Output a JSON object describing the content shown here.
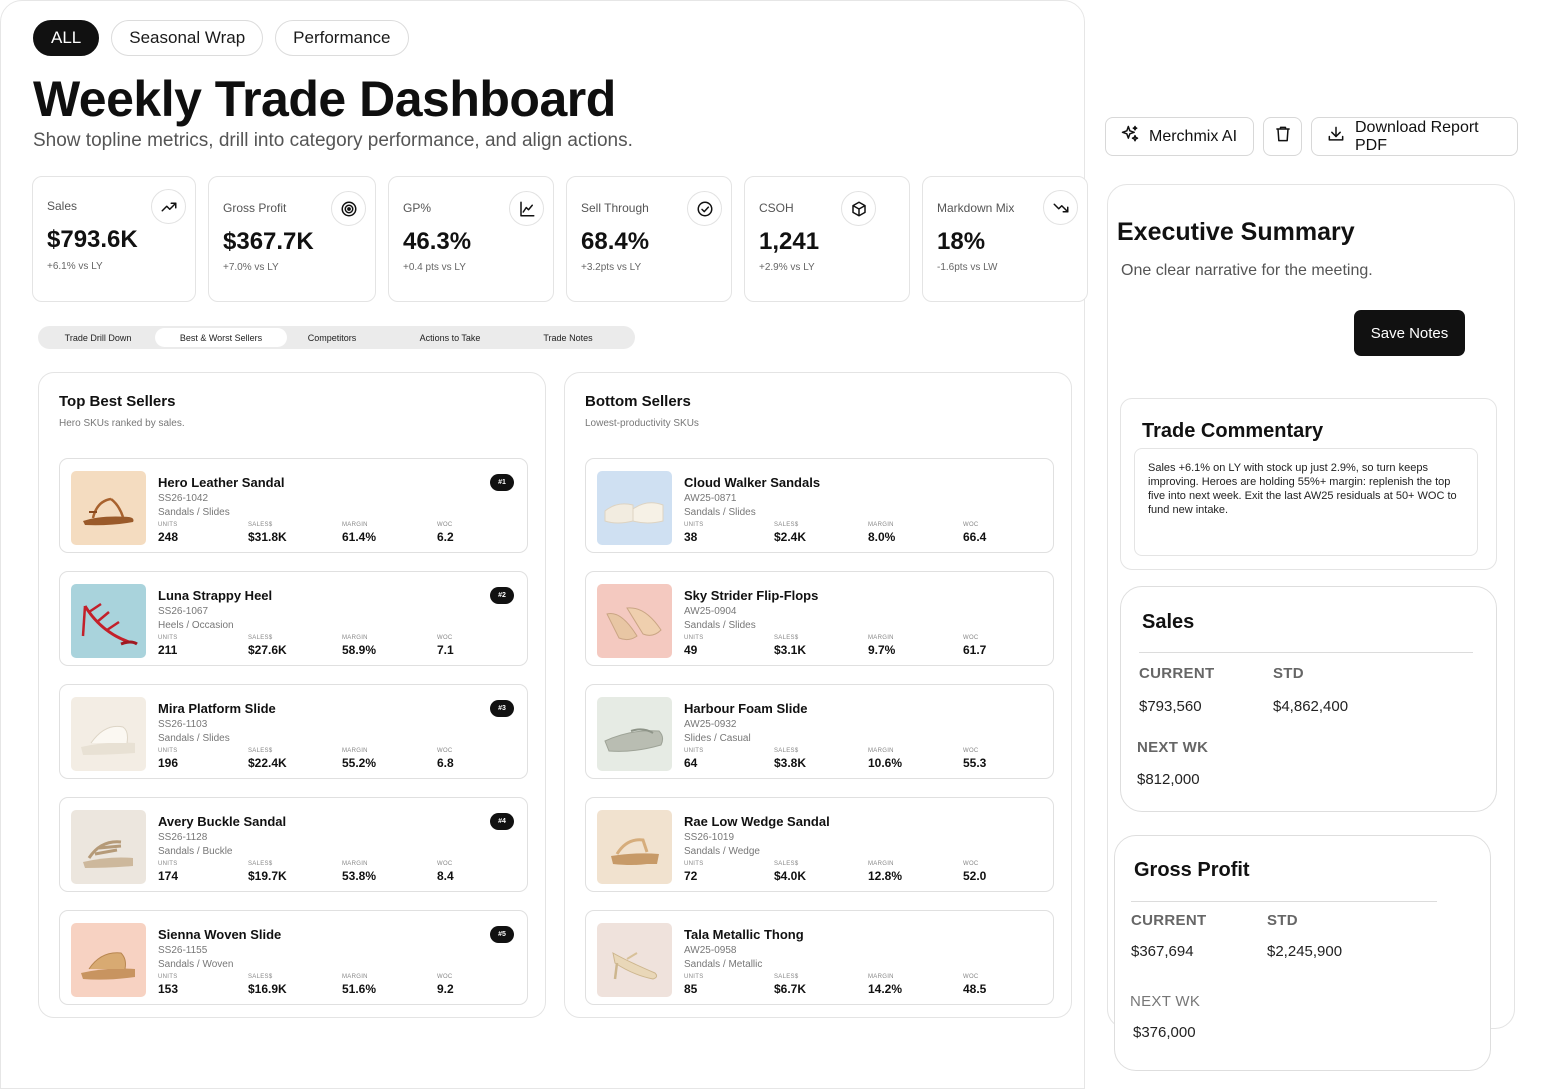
{
  "filters": [
    "ALL",
    "Seasonal Wrap",
    "Performance"
  ],
  "page": {
    "title": "Weekly Trade Dashboard",
    "subtitle": "Show topline metrics, drill into category performance, and align actions."
  },
  "kpis": [
    {
      "label": "Sales",
      "value": "$793.6K",
      "delta": "+6.1% vs LY",
      "icon": "trend-up-icon"
    },
    {
      "label": "Gross Profit",
      "value": "$367.7K",
      "delta": "+7.0% vs LY",
      "icon": "target-icon"
    },
    {
      "label": "GP%",
      "value": "46.3%",
      "delta": "+0.4 pts vs LY",
      "icon": "line-chart-icon"
    },
    {
      "label": "Sell Through",
      "value": "68.4%",
      "delta": "+3.2pts vs LY",
      "icon": "check-circle-icon"
    },
    {
      "label": "CSOH",
      "value": "1,241",
      "delta": "+2.9% vs LY",
      "icon": "box-icon"
    },
    {
      "label": "Markdown Mix",
      "value": "18%",
      "delta": "-1.6pts vs LW",
      "icon": "trend-down-icon"
    }
  ],
  "tabs": [
    "Trade Drill Down",
    "Best & Worst Sellers",
    "Competitors",
    "Actions to Take",
    "Trade Notes"
  ],
  "active_tab": "Best & Worst Sellers",
  "metric_labels": {
    "units": "UNITS",
    "sales": "SALES$",
    "margin": "MARGIN",
    "woc": "WOC"
  },
  "best_sellers": {
    "title": "Top Best Sellers",
    "subtitle": "Hero SKUs ranked by sales.",
    "items": [
      {
        "name": "Hero Leather Sandal",
        "code": "SS26-1042",
        "category": "Sandals / Slides",
        "units": "248",
        "sales": "$31.8K",
        "margin": "61.4%",
        "woc": "6.2",
        "rank": "#1"
      },
      {
        "name": "Luna Strappy Heel",
        "code": "SS26-1067",
        "category": "Heels / Occasion",
        "units": "211",
        "sales": "$27.6K",
        "margin": "58.9%",
        "woc": "7.1",
        "rank": "#2"
      },
      {
        "name": "Mira Platform Slide",
        "code": "SS26-1103",
        "category": "Sandals / Slides",
        "units": "196",
        "sales": "$22.4K",
        "margin": "55.2%",
        "woc": "6.8",
        "rank": "#3"
      },
      {
        "name": "Avery Buckle Sandal",
        "code": "SS26-1128",
        "category": "Sandals / Buckle",
        "units": "174",
        "sales": "$19.7K",
        "margin": "53.8%",
        "woc": "8.4",
        "rank": "#4"
      },
      {
        "name": "Sienna Woven Slide",
        "code": "SS26-1155",
        "category": "Sandals / Woven",
        "units": "153",
        "sales": "$16.9K",
        "margin": "51.6%",
        "woc": "9.2",
        "rank": "#5"
      }
    ]
  },
  "bottom_sellers": {
    "title": "Bottom Sellers",
    "subtitle": "Lowest-productivity SKUs",
    "items": [
      {
        "name": "Cloud Walker Sandals",
        "code": "AW25-0871",
        "category": "Sandals / Slides",
        "units": "38",
        "sales": "$2.4K",
        "margin": "8.0%",
        "woc": "66.4"
      },
      {
        "name": "Sky Strider Flip-Flops",
        "code": "AW25-0904",
        "category": "Sandals / Slides",
        "units": "49",
        "sales": "$3.1K",
        "margin": "9.7%",
        "woc": "61.7"
      },
      {
        "name": "Harbour Foam Slide",
        "code": "AW25-0932",
        "category": "Slides / Casual",
        "units": "64",
        "sales": "$3.8K",
        "margin": "10.6%",
        "woc": "55.3"
      },
      {
        "name": "Rae Low Wedge Sandal",
        "code": "SS26-1019",
        "category": "Sandals / Wedge",
        "units": "72",
        "sales": "$4.0K",
        "margin": "12.8%",
        "woc": "52.0"
      },
      {
        "name": "Tala Metallic Thong",
        "code": "AW25-0958",
        "category": "Sandals / Metallic",
        "units": "85",
        "sales": "$6.7K",
        "margin": "14.2%",
        "woc": "48.5"
      }
    ]
  },
  "actions": {
    "ai_label": "Merchmix AI",
    "download_label": "Download Report PDF"
  },
  "executive_summary": {
    "title": "Executive Summary",
    "subtitle": "One clear narrative for the meeting.",
    "save_label": "Save Notes",
    "commentary_title": "Trade Commentary",
    "commentary_text": "Sales +6.1% on LY with stock up just 2.9%, so turn keeps improving. Heroes are holding 55%+ margin: replenish the top five into next week. Exit the last AW25 residuals at 50+ WOC to fund new intake."
  },
  "sales_card": {
    "title": "Sales",
    "current_label": "CURRENT",
    "current_value": "$793,560",
    "std_label": "STD",
    "std_value": "$4,862,400",
    "next_label": "NEXT WK",
    "next_value": "$812,000"
  },
  "gp_card": {
    "title": "Gross Profit",
    "current_label": "CURRENT",
    "current_value": "$367,694",
    "std_label": "STD",
    "std_value": "$2,245,900",
    "next_label": "NEXT WK",
    "next_value": "$376,000"
  },
  "colors": {
    "accent": "#111111",
    "border": "#e4e4e4",
    "tab_bg": "#ebebeb"
  }
}
